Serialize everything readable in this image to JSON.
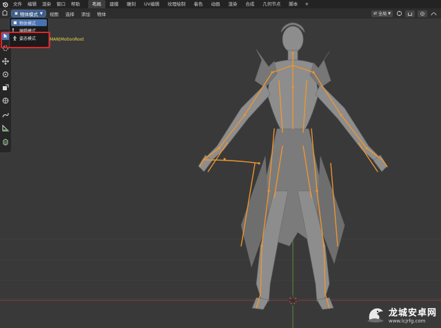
{
  "menubar": {
    "items": [
      "文件",
      "编辑",
      "渲染",
      "窗口",
      "帮助"
    ],
    "tabs": [
      "布局",
      "建模",
      "雕刻",
      "UV编辑",
      "纹理绘制",
      "着色",
      "动画",
      "渲染",
      "合成",
      "几何节点",
      "脚本"
    ],
    "active_tab": "布局",
    "add_tab": "+"
  },
  "header": {
    "mode_label": "物体模式",
    "menus": [
      "视图",
      "选择",
      "添加",
      "物体"
    ],
    "transform_orientation": "全局"
  },
  "mode_dropdown": {
    "options": [
      {
        "label": "物体模式",
        "icon": "object-mode-icon",
        "selected": true
      },
      {
        "label": "编辑模式",
        "icon": "edit-mode-icon",
        "selected": false
      },
      {
        "label": "姿态模式",
        "icon": "pose-mode-icon",
        "selected": false
      }
    ]
  },
  "viewport": {
    "bone_label": "MAN|MotionRoot"
  },
  "watermark": {
    "title": "龙城安卓网",
    "url": "www.lcjrfg.com"
  },
  "colors": {
    "accent": "#4772b3",
    "bone": "#f0962e",
    "highlight": "#e0262b",
    "background": "#393939"
  }
}
